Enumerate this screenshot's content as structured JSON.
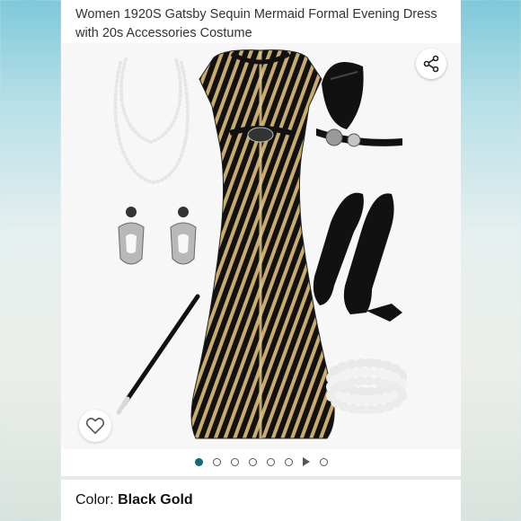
{
  "product": {
    "title": "Women 1920S Gatsby Sequin Mermaid Formal Evening Dress with 20s Accessories Costume"
  },
  "gallery": {
    "image_count": 7,
    "active_index": 0,
    "has_video": true,
    "share_icon": "share-icon",
    "favorite_icon": "heart-icon"
  },
  "variation": {
    "label": "Color:",
    "value": "Black Gold"
  },
  "colors": {
    "accent": "#0f6a7d",
    "dress_gold": "#c8a866",
    "dress_black": "#111111"
  }
}
